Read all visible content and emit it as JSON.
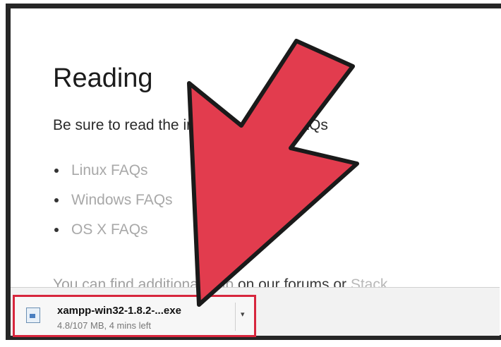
{
  "page": {
    "heading": "Reading",
    "intro": "Be sure to read the instructions and FAQs",
    "faq_links": [
      "Linux FAQs",
      "Windows FAQs",
      "OS X FAQs"
    ],
    "more_prefix": "You can find additional help ",
    "more_dark": "on our forums or ",
    "more_link": "Stack"
  },
  "download": {
    "filename": "xampp-win32-1.8.2-...exe",
    "status": "4.8/107 MB, 4 mins left",
    "menu_caret": "▾",
    "icon": "file-exe-icon"
  },
  "colors": {
    "arrow_fill": "#e23c4e",
    "arrow_stroke": "#1a1a1a",
    "highlight_border": "#d7263d",
    "link_gray": "#a8a8a8"
  }
}
